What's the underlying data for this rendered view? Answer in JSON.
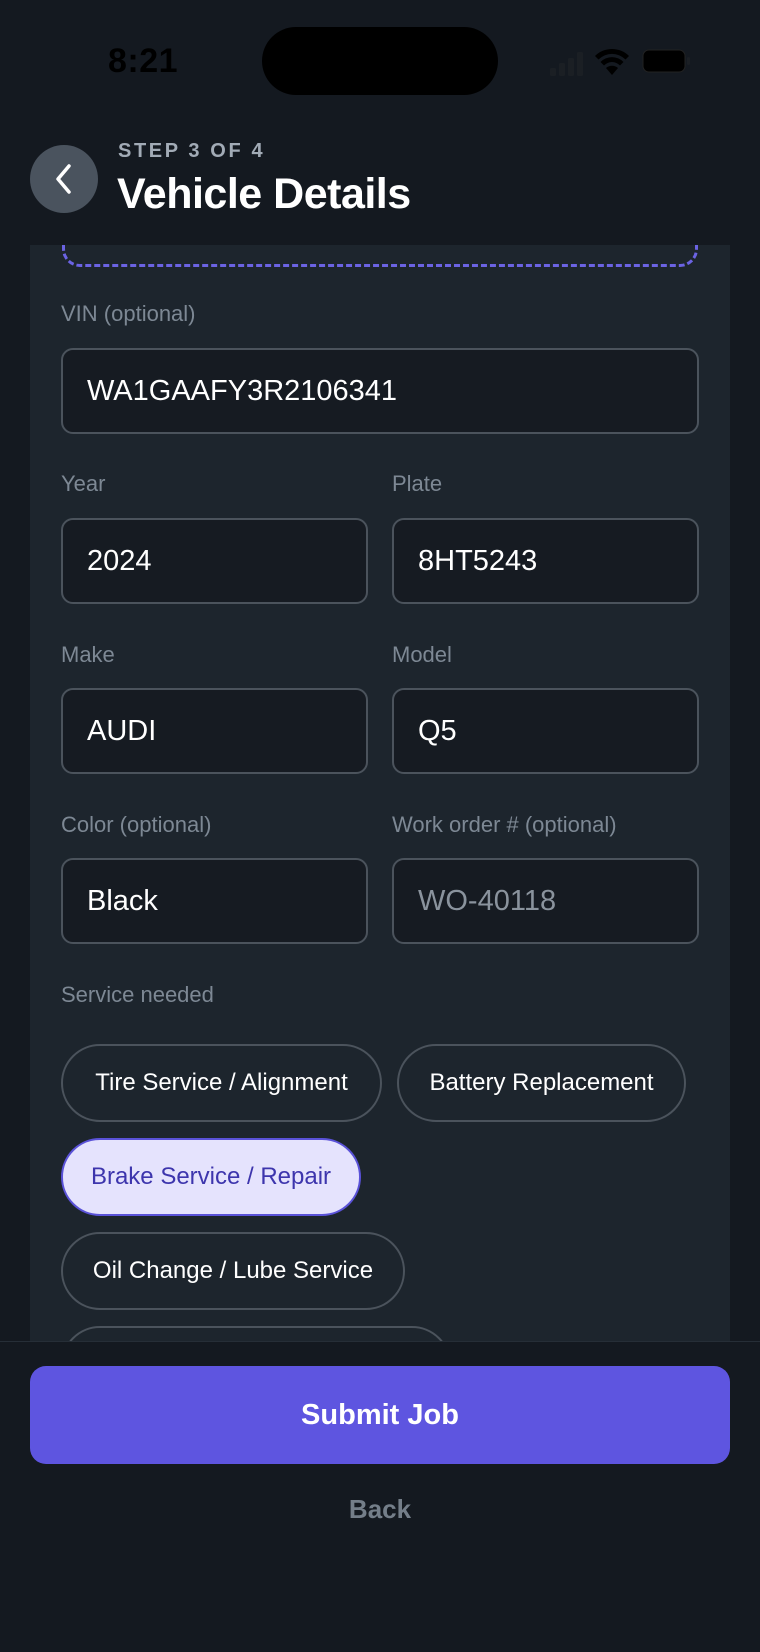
{
  "status_bar": {
    "time": "8:21"
  },
  "header": {
    "step": "STEP 3 OF 4",
    "title": "Vehicle Details"
  },
  "form": {
    "vin": {
      "label": "VIN (optional)",
      "value": "WA1GAAFY3R2106341"
    },
    "year": {
      "label": "Year",
      "value": "2024"
    },
    "plate": {
      "label": "Plate",
      "value": "8HT5243"
    },
    "make": {
      "label": "Make",
      "value": "AUDI"
    },
    "model": {
      "label": "Model",
      "value": "Q5"
    },
    "color": {
      "label": "Color (optional)",
      "value": "Black"
    },
    "work_order": {
      "label": "Work order # (optional)",
      "placeholder": "WO-40118"
    }
  },
  "services": {
    "label": "Service needed",
    "options": [
      {
        "label": "Tire Service / Alignment",
        "selected": false
      },
      {
        "label": "Battery Replacement",
        "selected": false
      },
      {
        "label": "Brake Service / Repair",
        "selected": true
      },
      {
        "label": "Oil Change / Lube Service",
        "selected": false
      }
    ]
  },
  "footer": {
    "submit_label": "Submit Job",
    "back_label": "Back"
  },
  "colors": {
    "background": "#141920",
    "card": "#1d252d",
    "accent": "#5e55e0",
    "selected_chip_bg": "#e5e3fd",
    "selected_chip_text": "#3d35ad"
  },
  "icons": [
    "back-chevron-icon",
    "signal-icon",
    "wifi-icon",
    "battery-icon"
  ]
}
